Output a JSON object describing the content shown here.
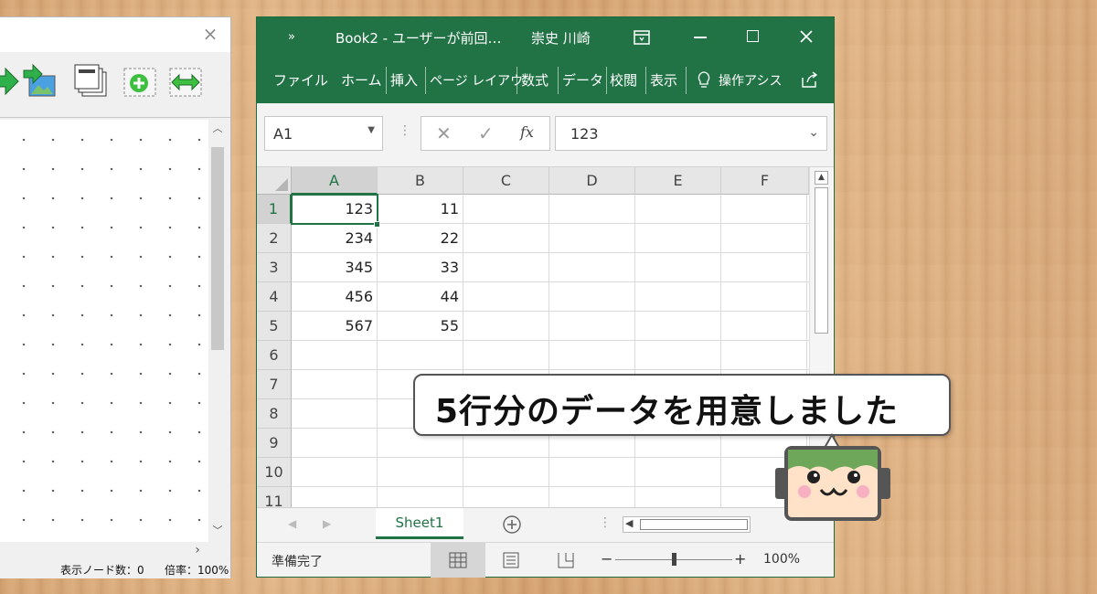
{
  "left_app": {
    "close_glyph": "×",
    "status_nodes": "表示ノード数：0",
    "status_zoom": "倍率：100%"
  },
  "excel": {
    "title": "Book2  -  ユーザーが前回…",
    "user": "崇史 川崎",
    "ribbon_tabs": [
      "ファイル",
      "ホーム",
      "挿入",
      "ページ レイアウ",
      "数式",
      "データ",
      "校閲",
      "表示",
      "操作アシス"
    ],
    "name_box": "A1",
    "formula_value": "123",
    "fx_label": "fx",
    "columns": [
      "A",
      "B",
      "C",
      "D",
      "E",
      "F"
    ],
    "rows": [
      "1",
      "2",
      "3",
      "4",
      "5",
      "6",
      "7",
      "8",
      "9",
      "10",
      "11"
    ],
    "cells": [
      [
        "123",
        "11"
      ],
      [
        "234",
        "22"
      ],
      [
        "345",
        "33"
      ],
      [
        "456",
        "44"
      ],
      [
        "567",
        "55"
      ]
    ],
    "sheet_tab": "Sheet1",
    "status_ready": "準備完了",
    "zoom": "100%",
    "zoom_level": 0.5
  },
  "callout": {
    "text": "5行分のデータを用意しました"
  },
  "colors": {
    "excel_green": "#217346",
    "desktop_wood": "#deb084"
  }
}
